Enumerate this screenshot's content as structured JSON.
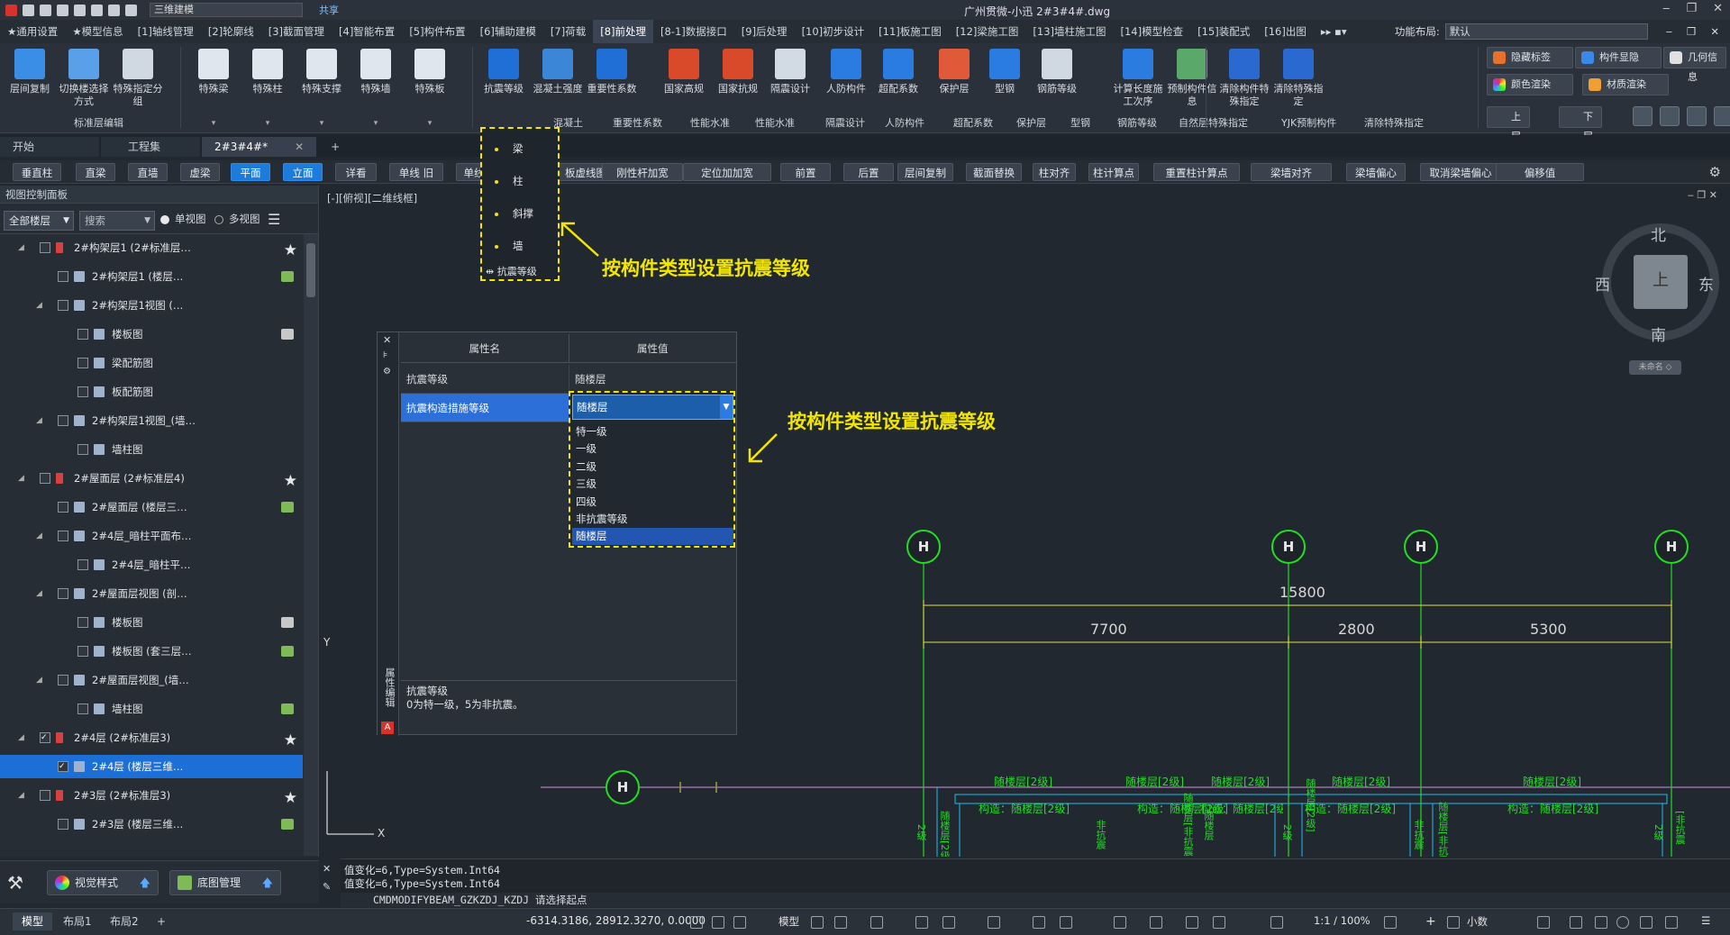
{
  "title_bar": {
    "workspace": "三维建模",
    "share": "共享",
    "title": "广州贯微-小迅    2#3#4#.dwg"
  },
  "menu_tabs": [
    "★通用设置",
    "★模型信息",
    "[1]轴线管理",
    "[2]轮廓线",
    "[3]截面管理",
    "[4]智能布置",
    "[5]构件布置",
    "[6]辅助建模",
    "[7]荷载",
    "[8]前处理",
    "[8-1]数据接口",
    "[9]后处理",
    "[10]初步设计",
    "[11]板施工图",
    "[12]梁施工图",
    "[13]墙柱施工图",
    "[14]模型检查",
    "[15]装配式",
    "[16]出图"
  ],
  "active_tab_index": 9,
  "function_layout": {
    "label": "功能布局:",
    "value": "默认"
  },
  "ribbon": {
    "buttons": [
      {
        "label": "层间复制",
        "color": "#3a8ee6"
      },
      {
        "label": "切换楼选择方式",
        "color": "#5aa0e8"
      },
      {
        "label": "特殊指定分组",
        "color": "#d0d8e2"
      },
      {
        "label": "特殊梁",
        "color": "#e0e6ee"
      },
      {
        "label": "特殊柱",
        "color": "#e0e6ee"
      },
      {
        "label": "特殊支撑",
        "color": "#e0e6ee"
      },
      {
        "label": "特殊墙",
        "color": "#e0e6ee"
      },
      {
        "label": "特殊板",
        "color": "#e0e6ee"
      },
      {
        "label": "抗震等级",
        "color": "#1f6fd6"
      },
      {
        "label": "混凝土强度",
        "color": "#3c86d8"
      },
      {
        "label": "重要性系数",
        "color": "#1f6fd6"
      },
      {
        "label": "国家高规",
        "color": "#d84a2a"
      },
      {
        "label": "国家抗规",
        "color": "#d84a2a"
      },
      {
        "label": "隔震设计",
        "color": "#d2dae4"
      },
      {
        "label": "人防构件",
        "color": "#2a7ce0"
      },
      {
        "label": "超配系数",
        "color": "#2a7ce0"
      },
      {
        "label": "保护层",
        "color": "#e05a3a"
      },
      {
        "label": "型钢",
        "color": "#2a7ce0"
      },
      {
        "label": "钢筋等级",
        "color": "#d0d8e2"
      },
      {
        "label": "计算长度施工次序",
        "color": "#2a7ce0"
      },
      {
        "label": "预制构件信息",
        "color": "#5aa86a"
      },
      {
        "label": "清除构件特殊指定",
        "color": "#2a6ad0"
      },
      {
        "label": "清除特殊指定",
        "color": "#2a6ad0"
      }
    ],
    "groups": [
      "标准层编辑",
      "混凝土",
      "重要性系数",
      "性能水准",
      "性能水准",
      "隔震设计",
      "人防构件",
      "超配系数",
      "保护层",
      "型钢",
      "钢筋等级",
      "自然层特殊指定",
      "YJK预制构件",
      "清除特殊指定"
    ],
    "right_buttons": [
      "隐藏标签",
      "构件显隐",
      "几何信息",
      "颜色渲染",
      "材质渲染",
      "上层",
      "下层"
    ]
  },
  "doc_tabs": [
    "开始",
    "工程集",
    "2#3#4#*"
  ],
  "command_buttons": [
    "垂直柱",
    "直梁",
    "直墙",
    "虚梁",
    "平面",
    "立面",
    "详看",
    "单线 旧",
    "单线",
    "标",
    "板虚线图层",
    "刚性杆加宽",
    "定位加加宽",
    "前置",
    "后置",
    "层间复制",
    "截面替换",
    "柱对齐",
    "柱计算点",
    "重置柱计算点",
    "梁墙对齐",
    "梁墙偏心",
    "取消梁墙偏心",
    "偏移值"
  ],
  "left_panel": {
    "title": "视图控制面板",
    "floor_filter": "全部楼层",
    "search_placeholder": "搜索",
    "view_single": "单视图",
    "view_multi": "多视图",
    "tree": [
      {
        "label": "2#构架层1  (2#标准层…",
        "indent": 1,
        "right": "star"
      },
      {
        "label": "2#构架层1  (楼层…",
        "indent": 2,
        "right": "green"
      },
      {
        "label": "2#构架层1视图  (…",
        "indent": 2,
        "right": ""
      },
      {
        "label": "楼板图",
        "indent": 3,
        "right": "white"
      },
      {
        "label": "梁配筋图",
        "indent": 3,
        "right": ""
      },
      {
        "label": "板配筋图",
        "indent": 3,
        "right": ""
      },
      {
        "label": "2#构架层1视图_(墙…",
        "indent": 2,
        "right": ""
      },
      {
        "label": "墙柱图",
        "indent": 3,
        "right": ""
      },
      {
        "label": "2#屋面层  (2#标准层4)",
        "indent": 1,
        "right": "star"
      },
      {
        "label": "2#屋面层  (楼层三…",
        "indent": 2,
        "right": "green"
      },
      {
        "label": "2#4层_暗柱平面布…",
        "indent": 2,
        "right": ""
      },
      {
        "label": "2#4层_暗柱平…",
        "indent": 3,
        "right": ""
      },
      {
        "label": "2#屋面层视图  (剖…",
        "indent": 2,
        "right": ""
      },
      {
        "label": "楼板图",
        "indent": 3,
        "right": "white"
      },
      {
        "label": "楼板图  (套三层…",
        "indent": 3,
        "right": "green"
      },
      {
        "label": "2#屋面层视图_(墙…",
        "indent": 2,
        "right": ""
      },
      {
        "label": "墙柱图",
        "indent": 3,
        "right": "green"
      },
      {
        "label": "2#4层  (2#标准层3)",
        "indent": 1,
        "right": "star"
      },
      {
        "label": "2#4层  (楼层三维…",
        "indent": 2,
        "right": "",
        "selected": true
      },
      {
        "label": "2#3层  (2#标准层3)",
        "indent": 1,
        "right": "star"
      },
      {
        "label": "2#3层  (楼层三维…",
        "indent": 2,
        "right": "green"
      }
    ]
  },
  "viewport": {
    "label": "[-][俯视][二维线框]"
  },
  "annotation_menu": {
    "items": [
      "梁",
      "柱",
      "斜撑",
      "墙"
    ],
    "footer": "抗震等级"
  },
  "callouts": [
    "按构件类型设置抗震等级",
    "按构件类型设置抗震等级"
  ],
  "property_window": {
    "header_name": "属性名",
    "header_value": "属性值",
    "rows": [
      {
        "key": "抗震等级",
        "value": "随楼层"
      },
      {
        "key": "抗震构造措施等级",
        "value": "随楼层"
      }
    ],
    "dropdown_options": [
      "特一级",
      "一级",
      "二级",
      "三级",
      "四级",
      "非抗震等级",
      "随楼层"
    ],
    "highlighted_option": "随楼层",
    "side_label": "属性编辑",
    "desc_title": "抗震等级",
    "desc_text": "0为特一级，5为非抗震。"
  },
  "compass": {
    "n": "北",
    "s": "南",
    "e": "东",
    "w": "西",
    "center": "上",
    "unnamed": "未命名"
  },
  "drawing": {
    "total_dim": "15800",
    "dims": [
      "7700",
      "2800",
      "5300"
    ],
    "green_labels": [
      "随楼层[2级]",
      "随楼层[2级]",
      "随楼层[2级]",
      "随楼层[2级]",
      "随楼层[2级]"
    ],
    "green_labels2": [
      "构造：随楼层[2级]",
      "构造：随楼层[2级]",
      "构造：随楼层[2级]",
      "构造：随楼层[2级]",
      "构造：随楼层[2级]"
    ],
    "vertical_labels": [
      "2级",
      "随楼层[2级]",
      "非抗震",
      "随楼层[非抗震",
      "随楼层",
      "2级",
      "随楼层[2级]",
      "非抗震",
      "随楼层[非抗震",
      "2级",
      "[非抗震"
    ]
  },
  "command_line": {
    "lines": [
      "值变化=6,Type=System.Int64",
      "值变化=6,Type=System.Int64"
    ],
    "input": "CMDMODIFYBEAM_GZKZDJ_KZDJ 请选择起点"
  },
  "bottom_tools": [
    "视觉样式",
    "底图管理"
  ],
  "status": {
    "layout_tabs": [
      "模型",
      "布局1",
      "布局2"
    ],
    "coords": "-6314.3186, 28912.3270, 0.0000",
    "model": "模型",
    "scale": "1:1 / 100%",
    "decimal": "小数"
  }
}
